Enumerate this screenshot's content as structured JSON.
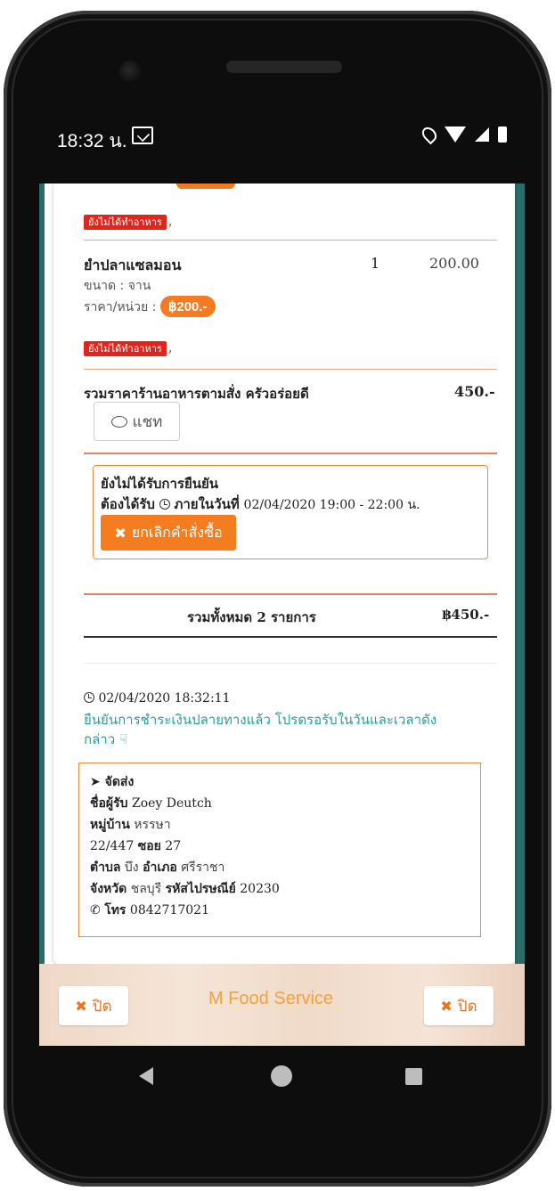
{
  "status_bar": {
    "time": "18:32 น."
  },
  "order": {
    "item1_status_badge": "ยังไม่ได้ทำอาหาร",
    "item2": {
      "name": "ยำปลาแซลมอน",
      "qty": "1",
      "price": "200.00",
      "size_label": "ขนาด : จาน",
      "unit_price_label": "ราคา/หน่วย :",
      "unit_price": "฿200.-",
      "status_badge": "ยังไม่ได้ทำอาหาร"
    },
    "restaurant_total_label": "รวมราคาร้านอาหารตามสั่ง ครัวอร่อยดี",
    "restaurant_total_value": "450.-",
    "chat_label": "แชท",
    "confirm": {
      "title": "ยังไม่ได้รับการยืนยัน",
      "receive_label": "ต้องได้รับ",
      "within_label": "ภายในวันที่",
      "datetime": "02/04/2020 19:00 - 22:00 น.",
      "cancel_label": "ยกเลิกคำสั่งซื้อ"
    },
    "grand_total_label": "รวมทั้งหมด 2 รายการ",
    "grand_total_value": "฿450.-"
  },
  "payment": {
    "timestamp": "02/04/2020 18:32:11",
    "message": "ยืนยันการชำระเงินปลายทางแล้ว โปรดรอรับในวันและเวลาดัง",
    "message_cont": "กล่าว"
  },
  "delivery": {
    "title": "จัดส่ง",
    "recipient_label": "ชื่อผู้รับ",
    "recipient": "Zoey Deutch",
    "village_label": "หมู่บ้าน",
    "village": "หรรษา",
    "house_no": "22/447",
    "soi_label": "ซอย",
    "soi": "27",
    "subdistrict_label": "ตำบล",
    "subdistrict": "บึง",
    "district_label": "อำเภอ",
    "district": "ศรีราชา",
    "province_label": "จังหวัด",
    "province": "ชลบุรี",
    "postcode_label": "รหัสไปรษณีย์",
    "postcode": "20230",
    "phone_label": "โทร",
    "phone": "0842717021"
  },
  "footer": {
    "title": "M Food Service",
    "close_left": "ปิด",
    "close_right": "ปิด"
  },
  "colors": {
    "accent_orange": "#f57b1e",
    "badge_red": "#e5231b",
    "teal_link": "#2a9d9a"
  }
}
